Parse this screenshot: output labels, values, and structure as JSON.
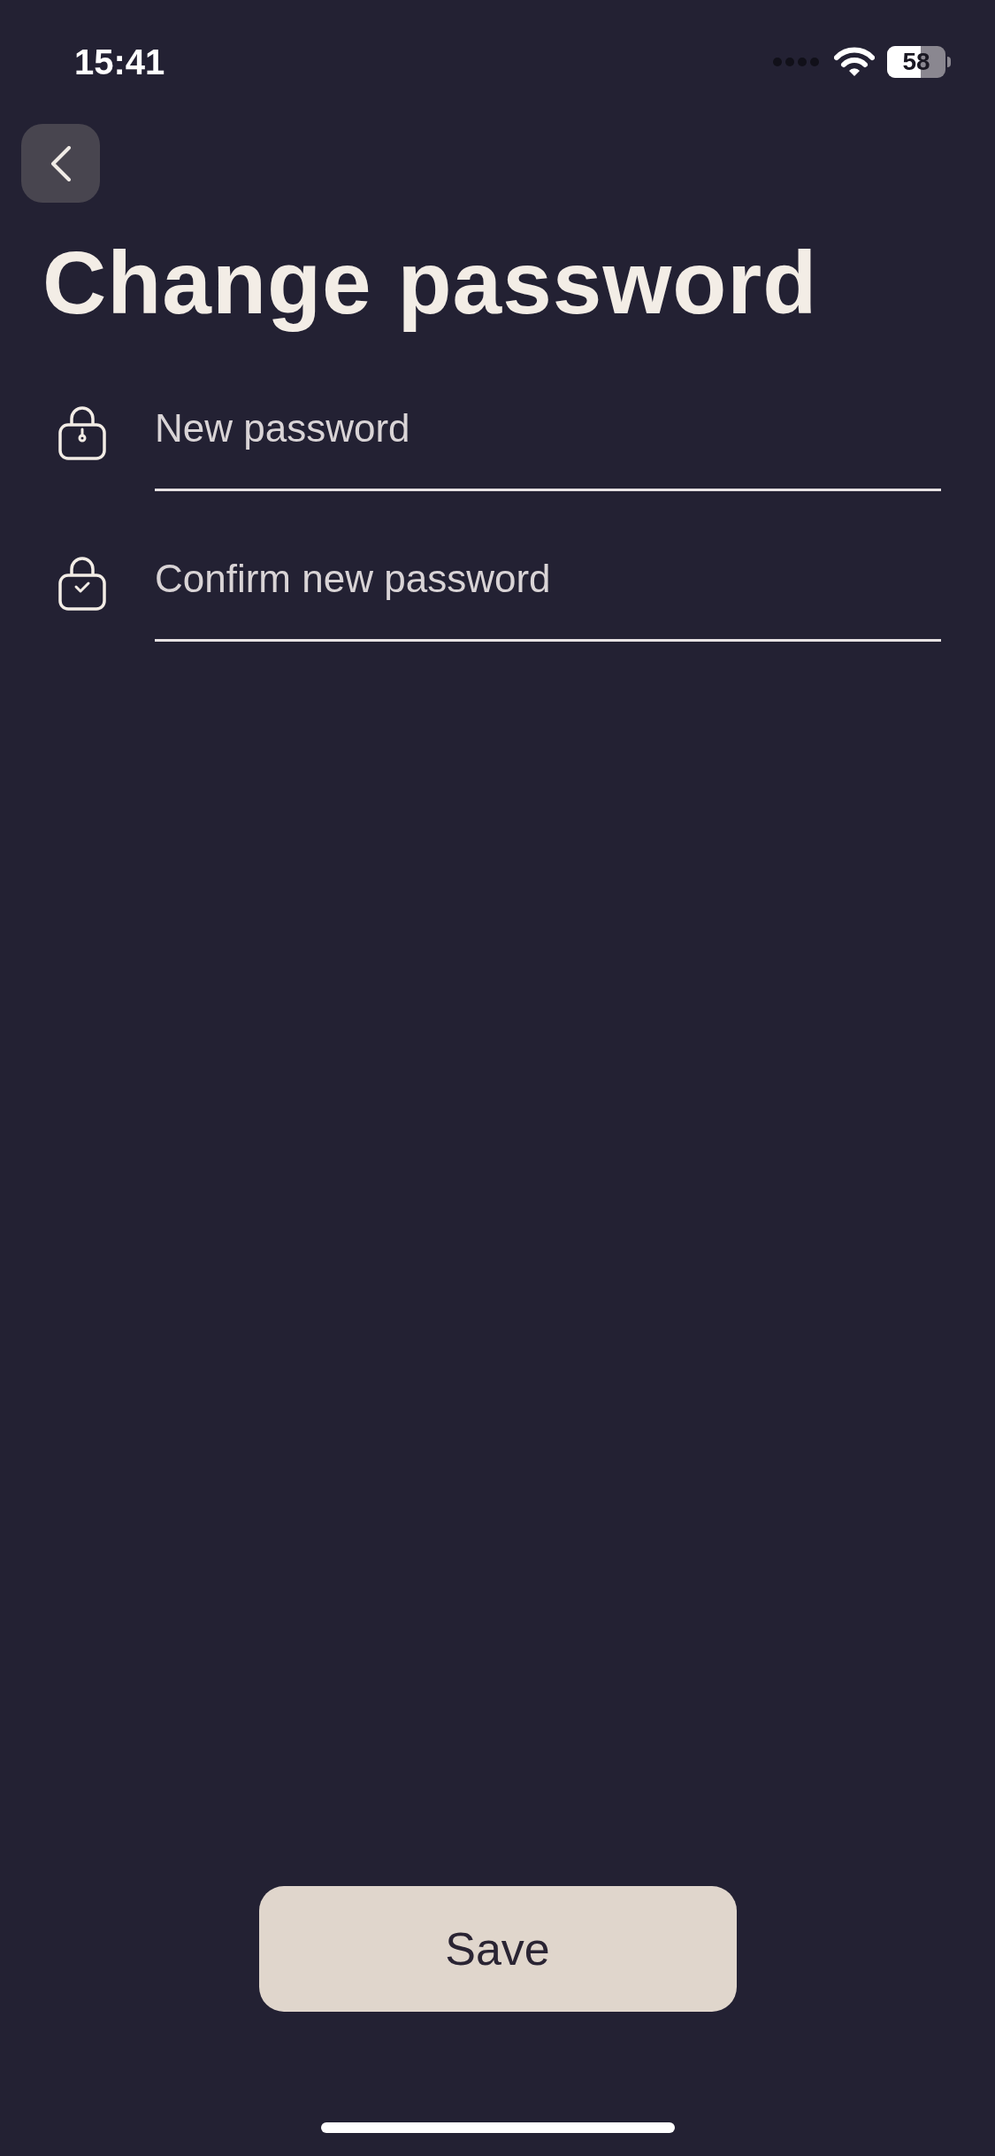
{
  "status_bar": {
    "time": "15:41",
    "battery": "58"
  },
  "title": "Change password",
  "fields": [
    {
      "kind": "lock",
      "placeholder": "New password"
    },
    {
      "kind": "lock-check",
      "placeholder": "Confirm new password"
    }
  ],
  "save_button": "Save"
}
